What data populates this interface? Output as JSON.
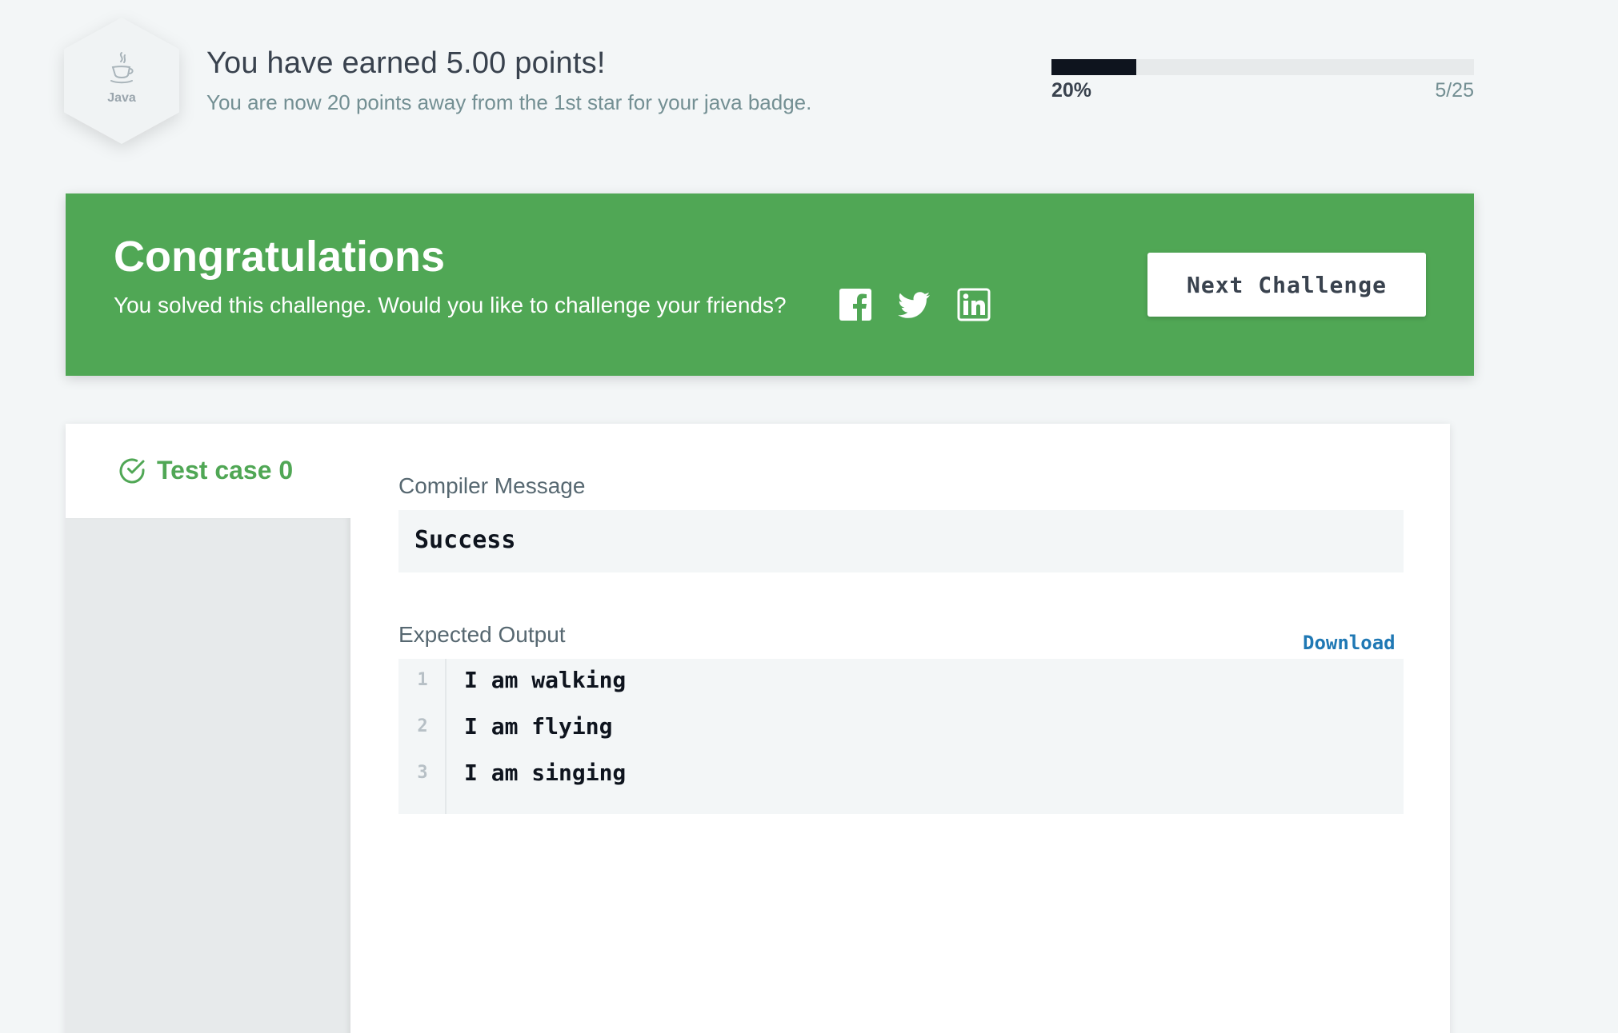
{
  "badge": {
    "label": "Java",
    "icon": "java-cup-icon"
  },
  "points": {
    "title": "You have earned 5.00 points!",
    "subtitle": "You are now 20 points away from the 1st star for your java badge."
  },
  "progress": {
    "fraction": 0.2,
    "percent_label": "20%",
    "count_label": "5/25"
  },
  "banner": {
    "title": "Congratulations",
    "subtitle": "You solved this challenge. Would you like to challenge your friends?",
    "share_icons": [
      "facebook-icon",
      "twitter-icon",
      "linkedin-icon"
    ],
    "next_button": "Next Challenge"
  },
  "results": {
    "test_case_tab": "Test case 0",
    "compiler_label": "Compiler Message",
    "compiler_message": "Success",
    "expected_label": "Expected Output",
    "download_label": "Download",
    "expected_lines": [
      {
        "num": "1",
        "text": "I am walking"
      },
      {
        "num": "2",
        "text": "I am flying"
      },
      {
        "num": "3",
        "text": "I am singing"
      }
    ]
  },
  "colors": {
    "success_green": "#50a755",
    "link_blue": "#1f78b4",
    "progress_fill": "#0e141e"
  }
}
